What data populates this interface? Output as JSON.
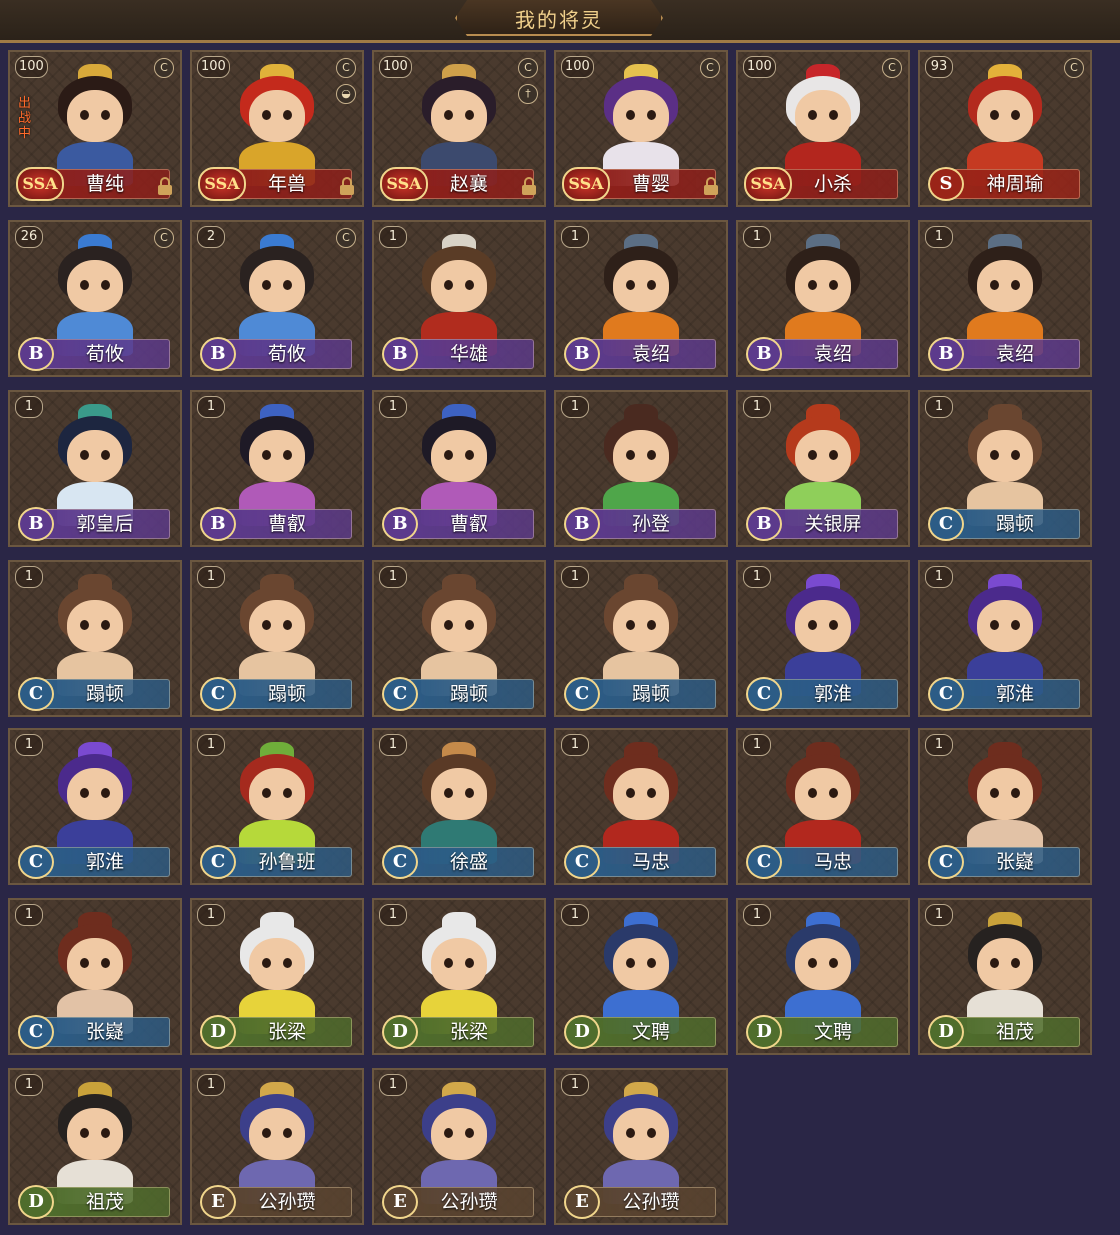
{
  "header": {
    "title": "我的将灵"
  },
  "colors": {
    "SSA": "#8f1f1a",
    "S": "#9a2418",
    "B": "#5c3a8c",
    "C": "#2c5c86",
    "D": "#4f6d2c",
    "E": "#5a4430"
  },
  "cards": [
    {
      "level": "100",
      "rank": "SSA",
      "name": "曹纯",
      "deployed": "出战中",
      "locked": true,
      "badges": [
        "currency-icon"
      ],
      "hair": "#2b1b16",
      "body": "#3b5aa0",
      "helmet": "#d8a93a"
    },
    {
      "level": "100",
      "rank": "SSA",
      "name": "年兽",
      "locked": true,
      "badges": [
        "currency-icon",
        "food-icon"
      ],
      "hair": "#c42a1c",
      "body": "#d9a52a",
      "helmet": "#e0b23a"
    },
    {
      "level": "100",
      "rank": "SSA",
      "name": "赵襄",
      "locked": true,
      "badges": [
        "currency-icon",
        "sword-icon"
      ],
      "hair": "#2a1d2a",
      "body": "#3c4a6e",
      "helmet": "#cfa04a"
    },
    {
      "level": "100",
      "rank": "SSA",
      "name": "曹婴",
      "locked": true,
      "badges": [
        "currency-icon"
      ],
      "hair": "#5b2f86",
      "body": "#e8e2ea",
      "helmet": "#e6c14e"
    },
    {
      "level": "100",
      "rank": "SSA",
      "name": "小杀",
      "badges": [
        "currency-icon"
      ],
      "hair": "#e8e6e6",
      "body": "#b3261e",
      "helmet": "#c7262a"
    },
    {
      "level": "93",
      "rank": "S",
      "name": "神周瑜",
      "badges": [
        "currency-icon"
      ],
      "hair": "#b32a1e",
      "body": "#c53a22",
      "helmet": "#e3b13a"
    },
    {
      "level": "26",
      "rank": "B",
      "name": "荀攸",
      "badges": [
        "currency-icon"
      ],
      "hair": "#2a2220",
      "body": "#4f8ad6",
      "helmet": "#3a7bd2"
    },
    {
      "level": "2",
      "rank": "B",
      "name": "荀攸",
      "badges": [
        "currency-icon"
      ],
      "hair": "#2a2220",
      "body": "#4f8ad6",
      "helmet": "#3a7bd2"
    },
    {
      "level": "1",
      "rank": "B",
      "name": "华雄",
      "badges": [],
      "hair": "#5a3c26",
      "body": "#b12c1e",
      "helmet": "#d8d2c6"
    },
    {
      "level": "1",
      "rank": "B",
      "name": "袁绍",
      "badges": [],
      "hair": "#2e2019",
      "body": "#e07a1e",
      "helmet": "#5b6e84"
    },
    {
      "level": "1",
      "rank": "B",
      "name": "袁绍",
      "badges": [],
      "hair": "#2e2019",
      "body": "#e07a1e",
      "helmet": "#5b6e84"
    },
    {
      "level": "1",
      "rank": "B",
      "name": "袁绍",
      "badges": [],
      "hair": "#2e2019",
      "body": "#e07a1e",
      "helmet": "#5b6e84"
    },
    {
      "level": "1",
      "rank": "B",
      "name": "郭皇后",
      "badges": [],
      "hair": "#1d2640",
      "body": "#d8e6f2",
      "helmet": "#3a9a8a"
    },
    {
      "level": "1",
      "rank": "B",
      "name": "曹叡",
      "badges": [],
      "hair": "#1e1a26",
      "body": "#b05ab8",
      "helmet": "#3d62c2"
    },
    {
      "level": "1",
      "rank": "B",
      "name": "曹叡",
      "badges": [],
      "hair": "#1e1a26",
      "body": "#b05ab8",
      "helmet": "#3d62c2"
    },
    {
      "level": "1",
      "rank": "B",
      "name": "孙登",
      "badges": [],
      "hair": "#4a2a20",
      "body": "#4fa64a",
      "helmet": "#4a2a20"
    },
    {
      "level": "1",
      "rank": "B",
      "name": "关银屏",
      "badges": [],
      "hair": "#b53a1c",
      "body": "#8fcf5a",
      "helmet": "#b53a1c"
    },
    {
      "level": "1",
      "rank": "C",
      "name": "蹋顿",
      "badges": [],
      "hair": "#6a4630",
      "body": "#e6c4a0",
      "helmet": "#6a4630"
    },
    {
      "level": "1",
      "rank": "C",
      "name": "蹋顿",
      "badges": [],
      "hair": "#6a4630",
      "body": "#e6c4a0",
      "helmet": "#6a4630"
    },
    {
      "level": "1",
      "rank": "C",
      "name": "蹋顿",
      "badges": [],
      "hair": "#6a4630",
      "body": "#e6c4a0",
      "helmet": "#6a4630"
    },
    {
      "level": "1",
      "rank": "C",
      "name": "蹋顿",
      "badges": [],
      "hair": "#6a4630",
      "body": "#e6c4a0",
      "helmet": "#6a4630"
    },
    {
      "level": "1",
      "rank": "C",
      "name": "蹋顿",
      "badges": [],
      "hair": "#6a4630",
      "body": "#e6c4a0",
      "helmet": "#6a4630"
    },
    {
      "level": "1",
      "rank": "C",
      "name": "郭淮",
      "badges": [],
      "hair": "#4b2a8c",
      "body": "#3b3f9a",
      "helmet": "#7a4ad0"
    },
    {
      "level": "1",
      "rank": "C",
      "name": "郭淮",
      "badges": [],
      "hair": "#4b2a8c",
      "body": "#3b3f9a",
      "helmet": "#7a4ad0"
    },
    {
      "level": "1",
      "rank": "C",
      "name": "郭淮",
      "badges": [],
      "hair": "#4b2a8c",
      "body": "#3b3f9a",
      "helmet": "#7a4ad0"
    },
    {
      "level": "1",
      "rank": "C",
      "name": "孙鲁班",
      "badges": [],
      "hair": "#a52a1e",
      "body": "#b6d93a",
      "helmet": "#6fae3a"
    },
    {
      "level": "1",
      "rank": "C",
      "name": "徐盛",
      "badges": [],
      "hair": "#5a3a26",
      "body": "#2f7a74",
      "helmet": "#c58a4a"
    },
    {
      "level": "1",
      "rank": "C",
      "name": "马忠",
      "badges": [],
      "hair": "#6e2d1e",
      "body": "#b2281e",
      "helmet": "#6e2d1e"
    },
    {
      "level": "1",
      "rank": "C",
      "name": "马忠",
      "badges": [],
      "hair": "#6e2d1e",
      "body": "#b2281e",
      "helmet": "#6e2d1e"
    },
    {
      "level": "1",
      "rank": "C",
      "name": "张嶷",
      "badges": [],
      "hair": "#6e2d1e",
      "body": "#e2c2a6",
      "helmet": "#6e2d1e"
    },
    {
      "level": "1",
      "rank": "C",
      "name": "张嶷",
      "badges": [],
      "hair": "#6e2d1e",
      "body": "#e2c2a6",
      "helmet": "#6e2d1e"
    },
    {
      "level": "1",
      "rank": "D",
      "name": "张梁",
      "badges": [],
      "hair": "#e8e8e8",
      "body": "#e7d33a",
      "helmet": "#e8e8e8"
    },
    {
      "level": "1",
      "rank": "D",
      "name": "张梁",
      "badges": [],
      "hair": "#e8e8e8",
      "body": "#e7d33a",
      "helmet": "#e8e8e8"
    },
    {
      "level": "1",
      "rank": "D",
      "name": "文聘",
      "badges": [],
      "hair": "#2a3a6a",
      "body": "#3d6fd1",
      "helmet": "#3d6fd1"
    },
    {
      "level": "1",
      "rank": "D",
      "name": "文聘",
      "badges": [],
      "hair": "#2a3a6a",
      "body": "#3d6fd1",
      "helmet": "#3d6fd1"
    },
    {
      "level": "1",
      "rank": "D",
      "name": "祖茂",
      "badges": [],
      "hair": "#262220",
      "body": "#e6e0d6",
      "helmet": "#c9a23a"
    },
    {
      "level": "1",
      "rank": "D",
      "name": "祖茂",
      "badges": [],
      "hair": "#262220",
      "body": "#e6e0d6",
      "helmet": "#c9a23a"
    },
    {
      "level": "1",
      "rank": "E",
      "name": "公孙瓒",
      "badges": [],
      "hair": "#3c3f8a",
      "body": "#6e68b0",
      "helmet": "#d2a84a"
    },
    {
      "level": "1",
      "rank": "E",
      "name": "公孙瓒",
      "badges": [],
      "hair": "#3c3f8a",
      "body": "#6e68b0",
      "helmet": "#d2a84a"
    },
    {
      "level": "1",
      "rank": "E",
      "name": "公孙瓒",
      "badges": [],
      "hair": "#3c3f8a",
      "body": "#6e68b0",
      "helmet": "#d2a84a"
    }
  ]
}
